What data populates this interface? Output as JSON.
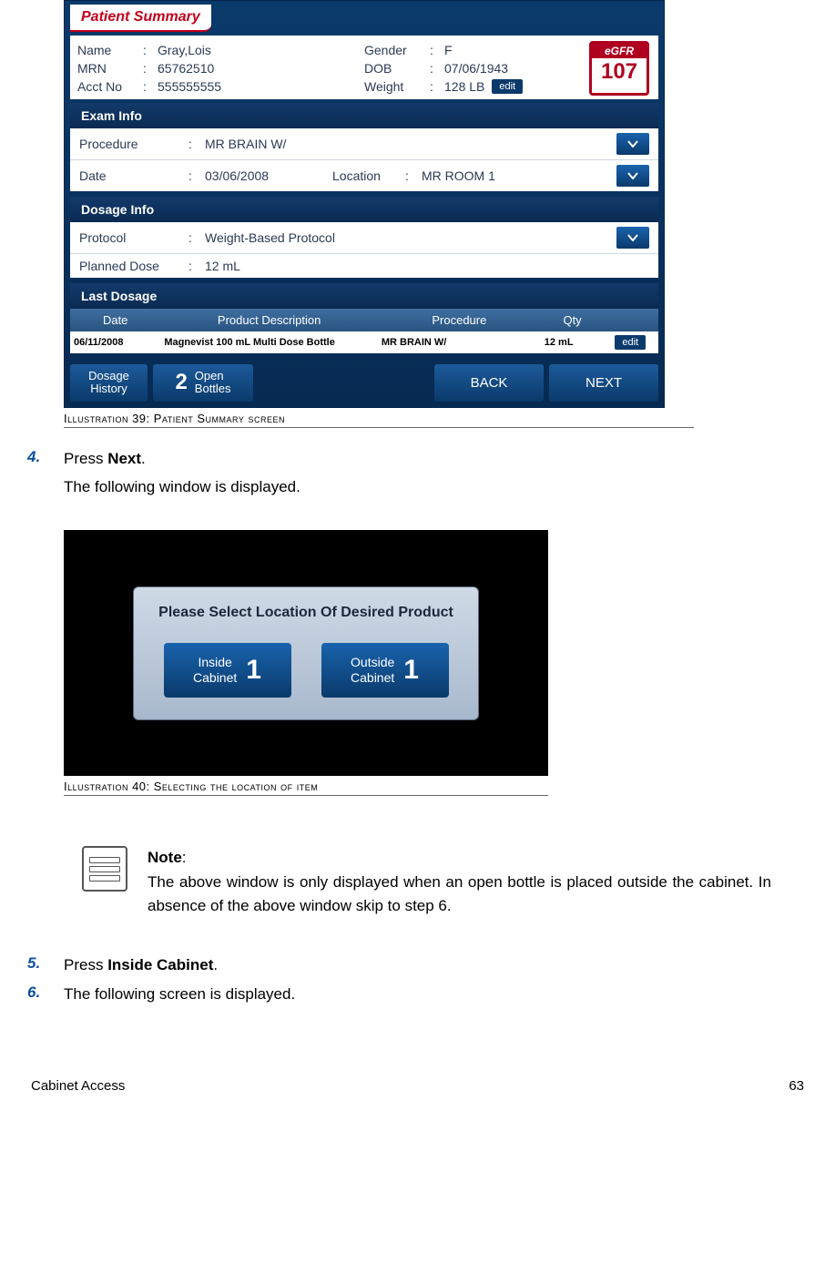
{
  "screen1": {
    "tab": "Patient Summary",
    "egfr_label": "eGFR",
    "egfr_value": "107",
    "edit_label": "edit",
    "name_lbl": "Name",
    "name_val": "Gray,Lois",
    "mrn_lbl": "MRN",
    "mrn_val": "65762510",
    "acct_lbl": "Acct No",
    "acct_val": "555555555",
    "gender_lbl": "Gender",
    "gender_val": "F",
    "dob_lbl": "DOB",
    "dob_val": "07/06/1943",
    "weight_lbl": "Weight",
    "weight_val": "128 LB",
    "exam_hdr": "Exam Info",
    "proc_lbl": "Procedure",
    "proc_val": "MR BRAIN W/",
    "date_lbl": "Date",
    "date_val": "03/06/2008",
    "loc_lbl": "Location",
    "loc_val": "MR ROOM 1",
    "dosage_hdr": "Dosage Info",
    "proto_lbl": "Protocol",
    "proto_val": "Weight-Based Protocol",
    "plan_lbl": "Planned Dose",
    "plan_val": "12 mL",
    "last_hdr": "Last Dosage",
    "cols": {
      "date": "Date",
      "prod": "Product Description",
      "proc": "Procedure",
      "qty": "Qty"
    },
    "row": {
      "date": "06/11/2008",
      "prod": "Magnevist 100 mL Multi Dose Bottle",
      "proc": "MR BRAIN W/",
      "qty": "12 mL"
    },
    "btn_dh_l1": "Dosage",
    "btn_dh_l2": "History",
    "btn_ob_num": "2",
    "btn_ob_l1": "Open",
    "btn_ob_l2": "Bottles",
    "btn_back": "BACK",
    "btn_next": "NEXT"
  },
  "caption1": "Illustration 39: Patient Summary screen",
  "step4_num": "4.",
  "step4_line1_pre": "Press ",
  "step4_line1_bold": "Next",
  "step4_line1_post": ".",
  "step4_line2": "The following window is displayed.",
  "screen2": {
    "title": "Please Select Location Of Desired Product",
    "inside_l1": "Inside",
    "inside_l2": "Cabinet",
    "inside_num": "1",
    "outside_l1": "Outside",
    "outside_l2": "Cabinet",
    "outside_num": "1"
  },
  "caption2": "Illustration 40: Selecting the location of item",
  "note_title": "Note",
  "note_body": "The above window is only displayed when an open bottle is placed outside the cabinet. In absence of the above window  skip to step 6.",
  "step5_num": "5.",
  "step5_pre": "Press ",
  "step5_bold": "Inside Cabinet",
  "step5_post": ".",
  "step6_num": "6.",
  "step6_text": "The following screen is displayed.",
  "footer_left": "Cabinet Access",
  "footer_right": "63"
}
